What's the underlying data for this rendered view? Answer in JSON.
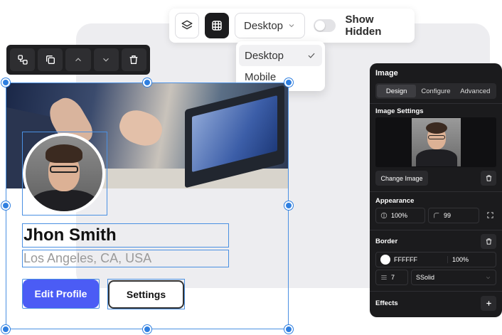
{
  "toolbar": {
    "device_selected": "Desktop",
    "show_hidden_label": "Show Hidden",
    "show_hidden_on": false
  },
  "device_dropdown": {
    "options": [
      "Desktop",
      "Mobile"
    ],
    "selected": "Desktop"
  },
  "element_toolbar": {
    "icons": [
      "group-icon",
      "duplicate-icon",
      "move-up-icon",
      "move-down-icon",
      "delete-icon"
    ]
  },
  "profile": {
    "name": "Jhon Smith",
    "location": "Los Angeles, CA, USA",
    "edit_button": "Edit Profile",
    "settings_button": "Settings"
  },
  "panel": {
    "title": "Image",
    "tabs": [
      "Design",
      "Configure",
      "Advanced"
    ],
    "active_tab": "Design",
    "image_settings_label": "Image Settings",
    "change_image_label": "Change Image",
    "appearance_label": "Appearance",
    "opacity": "100%",
    "radius": "99",
    "border_label": "Border",
    "border_color": "FFFFFF",
    "border_opacity": "100%",
    "border_width": "7",
    "border_style": "SSolid",
    "effects_label": "Effects"
  },
  "colors": {
    "accent": "#4b5cf5",
    "selection": "#4a90e2",
    "panel_bg": "#1b1b1d"
  }
}
